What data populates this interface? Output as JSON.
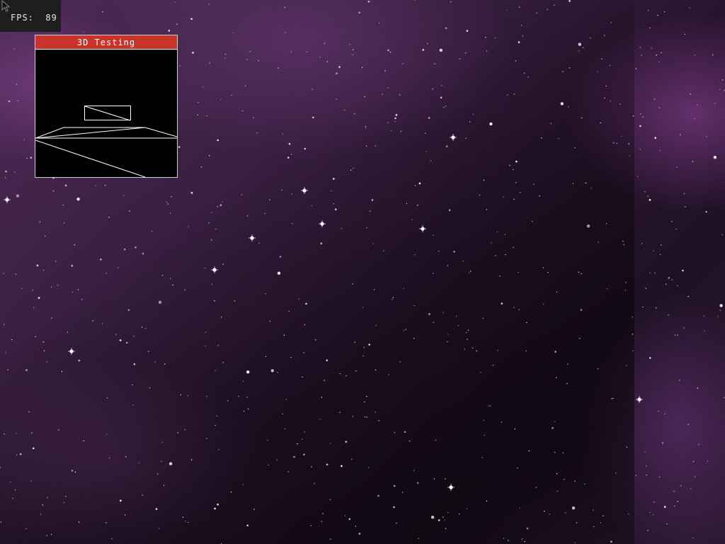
{
  "hud": {
    "fps_label": "FPS:",
    "fps_value": "89"
  },
  "window": {
    "title": "3D Testing"
  },
  "icons": {
    "cursor": "mouse-pointer-icon"
  },
  "colors": {
    "title_bar": "#c8342a",
    "viewport_bg": "#000000",
    "wireframe": "#ffffff",
    "hud_bg": "#1e1e1e"
  }
}
